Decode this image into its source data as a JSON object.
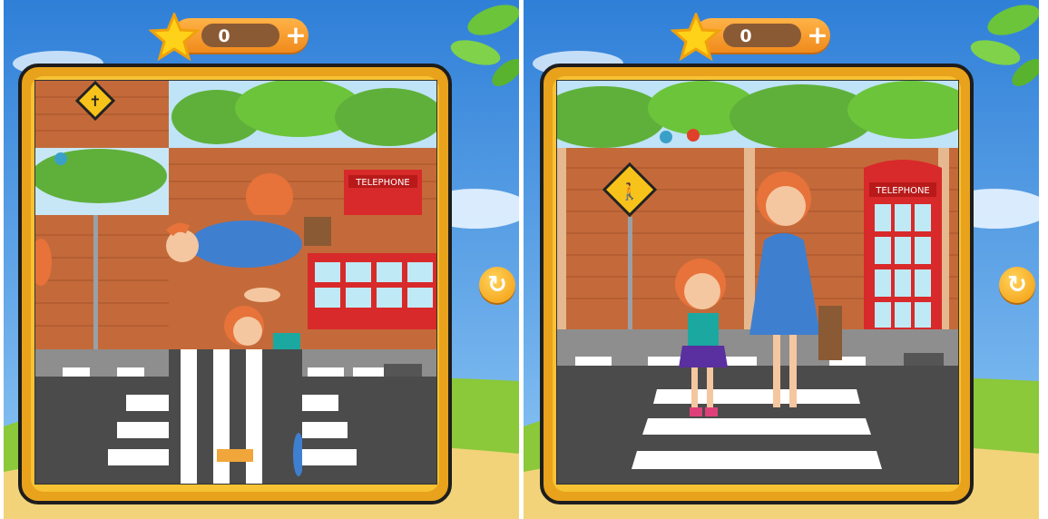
{
  "left_screen": {
    "coin_count": "0",
    "add_icon": "plus-icon",
    "refresh_icon": "refresh-icon",
    "phone_booth_label": "TELEPHONE",
    "puzzle_state": "scrambled"
  },
  "right_screen": {
    "coin_count": "0",
    "add_icon": "plus-icon",
    "refresh_icon": "refresh-icon",
    "phone_booth_label": "TELEPHONE",
    "puzzle_state": "solved"
  },
  "colors": {
    "sky": "#3d8de0",
    "frame": "#e8a21c",
    "brick": "#c46a3a",
    "road": "#4b4b4b",
    "accent": "#f39a0e"
  }
}
